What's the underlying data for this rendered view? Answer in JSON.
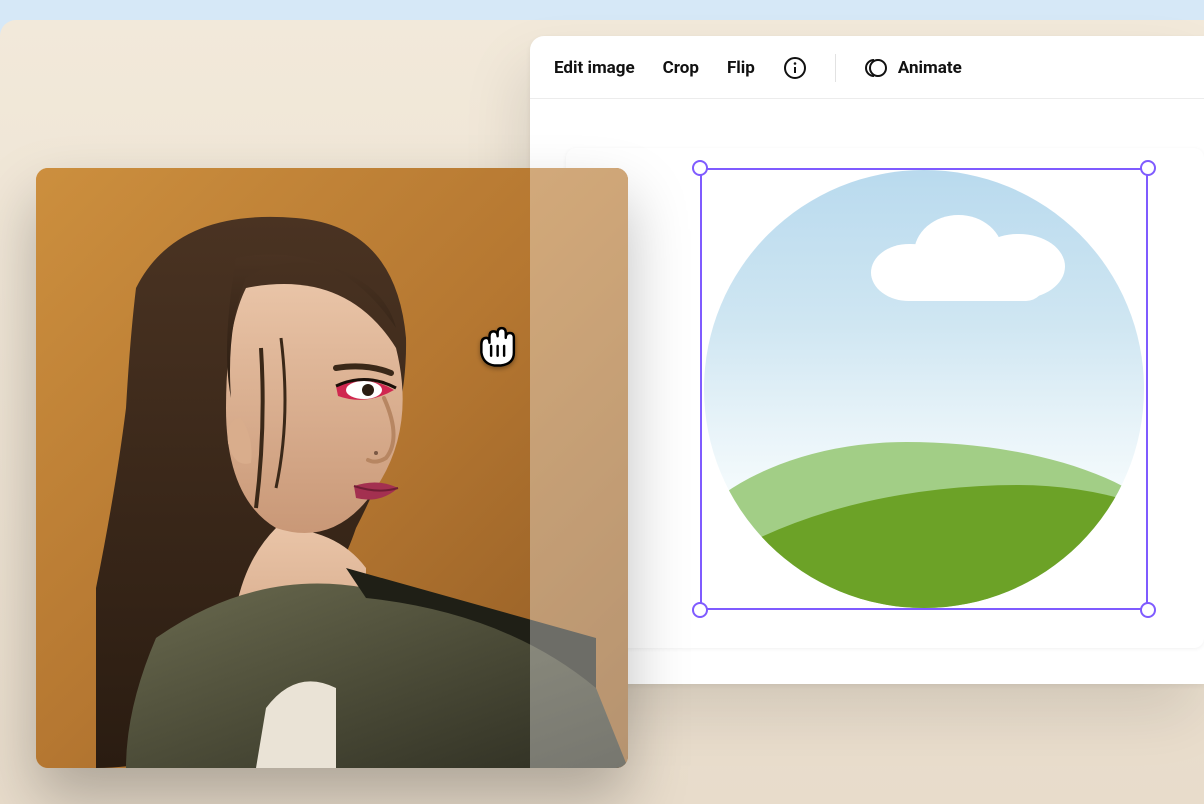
{
  "toolbar": {
    "edit_image": "Edit image",
    "crop": "Crop",
    "flip": "Flip",
    "animate": "Animate"
  },
  "selection": {
    "border_color": "#7f5bff"
  },
  "placeholder": {
    "type": "landscape-circle",
    "sky": "#b9daee",
    "hill_back": "#a2ce86",
    "hill_front": "#6ca227",
    "cloud": "#ffffff"
  },
  "drag_photo": {
    "description": "portrait-photo-being-dragged",
    "dominant_bg": "#b77630"
  }
}
